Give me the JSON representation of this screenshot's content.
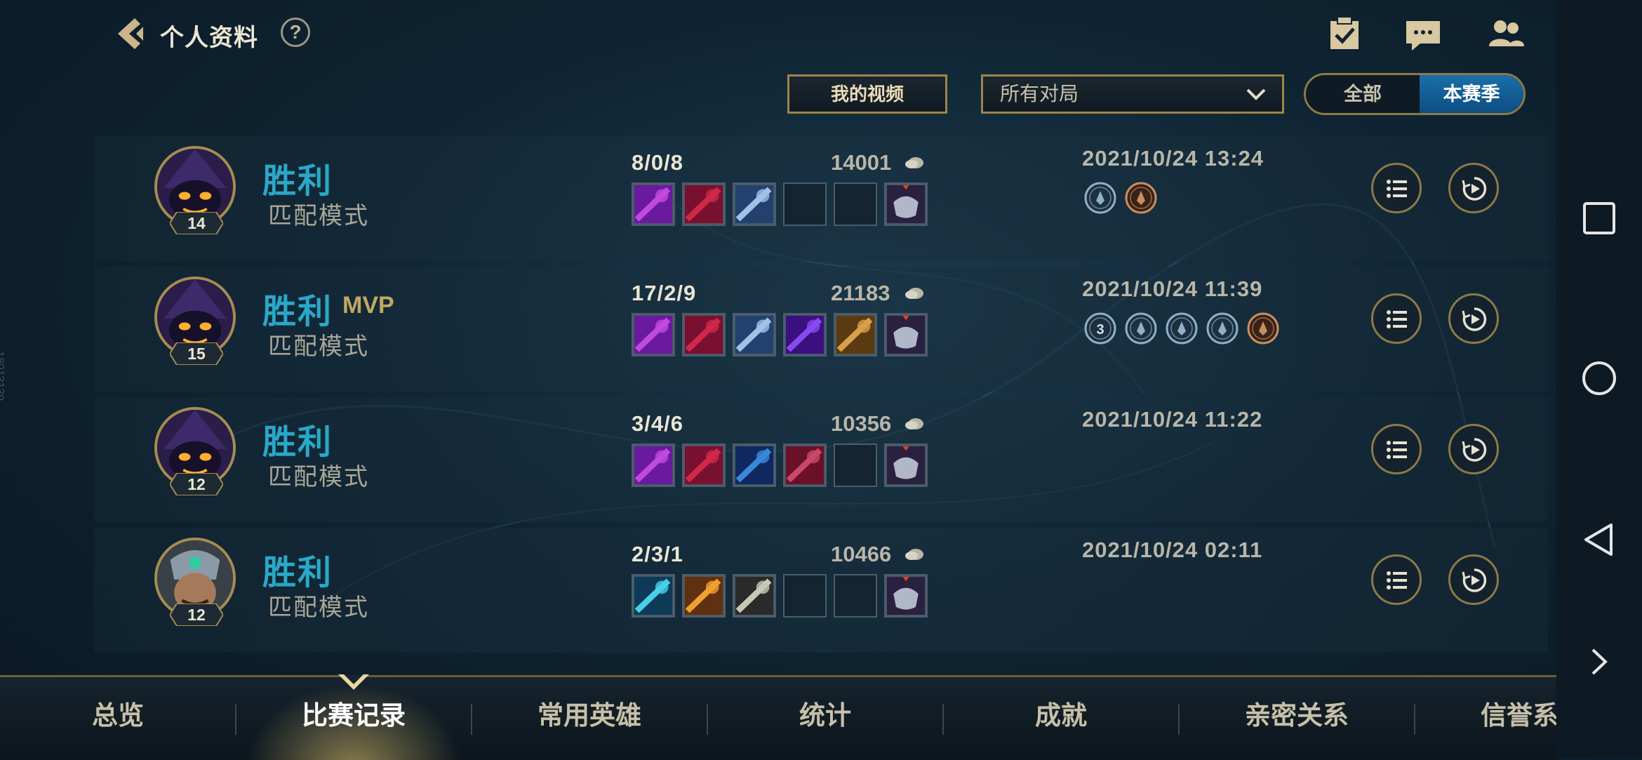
{
  "header": {
    "title": "个人资料",
    "help_label": "?",
    "icons": [
      "back-icon",
      "task-checklist-icon",
      "chat-icon",
      "friends-icon"
    ]
  },
  "filters": {
    "video_button": "我的视频",
    "match_filter_value": "所有对局",
    "toggle_all": "全部",
    "toggle_season": "本赛季",
    "toggle_selected": "本赛季"
  },
  "matches": [
    {
      "result": "胜利",
      "mvp": "",
      "mode": "匹配模式",
      "level": "14",
      "kda": "8/0/8",
      "gold": "14001",
      "time": "2021/10/24 13:24",
      "champion": "veigar",
      "items": [
        "purple-staff",
        "red-helm",
        "blue-armor",
        "empty",
        "empty",
        "trinket"
      ],
      "medals": [
        "blue-medal",
        "bronze-medal"
      ]
    },
    {
      "result": "胜利",
      "mvp": "MVP",
      "mode": "匹配模式",
      "level": "15",
      "kda": "17/2/9",
      "gold": "21183",
      "time": "2021/10/24 11:39",
      "champion": "veigar",
      "items": [
        "purple-staff",
        "red-helm",
        "blue-armor",
        "purple-orb",
        "gold-armor",
        "trinket"
      ],
      "medals": [
        "blue-medal-3",
        "blue-medal",
        "blue-medal",
        "blue-medal",
        "bronze-medal"
      ]
    },
    {
      "result": "胜利",
      "mvp": "",
      "mode": "匹配模式",
      "level": "12",
      "kda": "3/4/6",
      "gold": "10356",
      "time": "2021/10/24 11:22",
      "champion": "veigar",
      "items": [
        "purple-staff",
        "red-helm",
        "blue-wand",
        "red-book",
        "empty",
        "trinket"
      ],
      "medals": []
    },
    {
      "result": "胜利",
      "mvp": "",
      "mode": "匹配模式",
      "level": "12",
      "kda": "2/3/1",
      "gold": "10466",
      "time": "2021/10/24 02:11",
      "champion": "warrior",
      "items": [
        "cyan-claws",
        "orange-gem",
        "silver-blades",
        "empty",
        "empty",
        "trinket"
      ],
      "medals": []
    }
  ],
  "bottom_nav": {
    "items": [
      "总览",
      "比赛记录",
      "常用英雄",
      "统计",
      "成就",
      "亲密关系",
      "信誉系统"
    ],
    "active": "比赛记录"
  },
  "watermark": "18013139",
  "colors": {
    "result_win": "#2aa8c9",
    "accent_gold": "#9c8548",
    "toggle_active": "#0d4d82"
  }
}
